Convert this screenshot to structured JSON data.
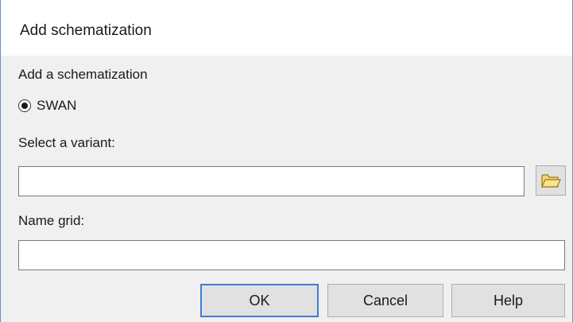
{
  "window": {
    "title": "Add schematization"
  },
  "form": {
    "section_label": "Add a schematization",
    "radio": {
      "label": "SWAN",
      "selected": true
    },
    "variant": {
      "label": "Select a variant:",
      "value": ""
    },
    "grid": {
      "label": "Name grid:",
      "value": ""
    },
    "browse_icon": "folder-open-icon"
  },
  "buttons": {
    "ok": "OK",
    "cancel": "Cancel",
    "help": "Help"
  },
  "colors": {
    "dialog_bg": "#f0f0f0",
    "title_bg": "#ffffff",
    "default_button_border": "#3c7fd1",
    "folder_icon": "#e8c84a"
  }
}
